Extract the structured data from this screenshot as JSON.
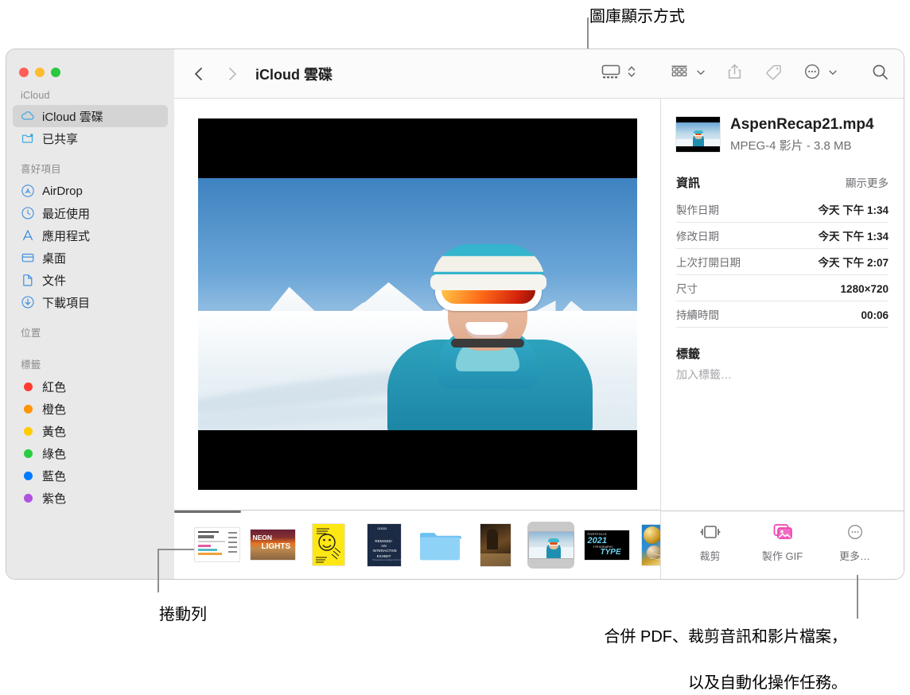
{
  "callouts": {
    "gallery_view": "圖庫顯示方式",
    "scrollbar": "捲動列",
    "quick_actions_line1": "合併 PDF、裁剪音訊和影片檔案，",
    "quick_actions_line2": "以及自動化操作任務。"
  },
  "window": {
    "traffic_lights": [
      "close",
      "minimize",
      "zoom"
    ]
  },
  "sidebar": {
    "groups": [
      {
        "header": "iCloud",
        "items": [
          {
            "label": "iCloud 雲碟",
            "icon": "cloud-icon",
            "selected": true
          },
          {
            "label": "已共享",
            "icon": "shared-folder-icon",
            "selected": false
          }
        ]
      },
      {
        "header": "喜好項目",
        "items": [
          {
            "label": "AirDrop",
            "icon": "airdrop-icon",
            "selected": false
          },
          {
            "label": "最近使用",
            "icon": "clock-icon",
            "selected": false
          },
          {
            "label": "應用程式",
            "icon": "applications-icon",
            "selected": false
          },
          {
            "label": "桌面",
            "icon": "desktop-icon",
            "selected": false
          },
          {
            "label": "文件",
            "icon": "document-icon",
            "selected": false
          },
          {
            "label": "下載項目",
            "icon": "downloads-icon",
            "selected": false
          }
        ]
      },
      {
        "header": "位置",
        "items": []
      },
      {
        "header": "標籤",
        "items": [
          {
            "label": "紅色",
            "icon": "tag-dot-icon",
            "color": "#ff3b30",
            "selected": false
          },
          {
            "label": "橙色",
            "icon": "tag-dot-icon",
            "color": "#ff9500",
            "selected": false
          },
          {
            "label": "黃色",
            "icon": "tag-dot-icon",
            "color": "#ffcc00",
            "selected": false
          },
          {
            "label": "綠色",
            "icon": "tag-dot-icon",
            "color": "#28cd41",
            "selected": false
          },
          {
            "label": "藍色",
            "icon": "tag-dot-icon",
            "color": "#007aff",
            "selected": false
          },
          {
            "label": "紫色",
            "icon": "tag-dot-icon",
            "color": "#af52de",
            "selected": false
          }
        ]
      }
    ]
  },
  "toolbar": {
    "back_icon": "chevron-left-icon",
    "forward_icon": "chevron-right-icon",
    "path_title": "iCloud 雲碟",
    "view_icon": "gallery-view-icon",
    "view_stepper_icon": "chevron-up-down-icon",
    "group_icon": "group-items-icon",
    "group_chevron_icon": "chevron-down-icon",
    "share_icon": "share-icon",
    "tag_icon": "tag-icon",
    "more_icon": "more-circle-icon",
    "more_chevron_icon": "chevron-down-icon",
    "search_icon": "search-icon"
  },
  "preview": {
    "media_type": "video",
    "letterboxed": true
  },
  "filmstrip": [
    {
      "name": "chart-document-thumbnail",
      "type": "doc",
      "selected": false
    },
    {
      "name": "neon-lights-poster-thumbnail",
      "type": "neon",
      "text": "NEON",
      "text2": "LIGHTS",
      "selected": false
    },
    {
      "name": "thank-you-poster-thumbnail",
      "type": "thanks",
      "selected": false
    },
    {
      "name": "remixed-exhibit-poster-thumbnail",
      "type": "remix",
      "text": "013021",
      "text2": "REMIXED: AN INTERACTIVE EXHIBIT",
      "selected": false
    },
    {
      "name": "folder-thumbnail",
      "type": "folder",
      "selected": false
    },
    {
      "name": "dark-interior-photo-thumbnail",
      "type": "dark",
      "selected": false
    },
    {
      "name": "aspen-recap-video-thumbnail",
      "type": "video",
      "selected": true
    },
    {
      "name": "typography-portfolio-thumbnail",
      "type": "type",
      "text": "PORTFOLIO",
      "text2": "2021",
      "text3": "TYPOGRAPHY",
      "text4": "TYPE",
      "selected": false
    },
    {
      "name": "gold-balloons-photo-thumbnail",
      "type": "gold",
      "selected": false
    }
  ],
  "scrollbar": {
    "visible": true
  },
  "inspector": {
    "file_name": "AspenRecap21.mp4",
    "file_meta": "MPEG-4 影片 - 3.8 MB",
    "info_section": {
      "title": "資訊",
      "action": "顯示更多",
      "rows": [
        {
          "key": "製作日期",
          "value": "今天 下午 1:34"
        },
        {
          "key": "修改日期",
          "value": "今天 下午 1:34"
        },
        {
          "key": "上次打開日期",
          "value": "今天 下午 2:07"
        },
        {
          "key": "尺寸",
          "value": "1280×720"
        },
        {
          "key": "持續時間",
          "value": "00:06"
        }
      ]
    },
    "tags_section": {
      "title": "標籤",
      "placeholder": "加入標籤…"
    }
  },
  "quick_actions": [
    {
      "label": "裁剪",
      "icon": "trim-media-icon"
    },
    {
      "label": "製作 GIF",
      "icon": "make-gif-icon"
    },
    {
      "label": "更多…",
      "icon": "more-circle-icon"
    }
  ],
  "colors": {
    "accent_blue": "#007aff",
    "sidebar_bg": "#e9e9e9",
    "selected_row": "#d4d4d4",
    "gif_pink": "#ee43b0"
  }
}
